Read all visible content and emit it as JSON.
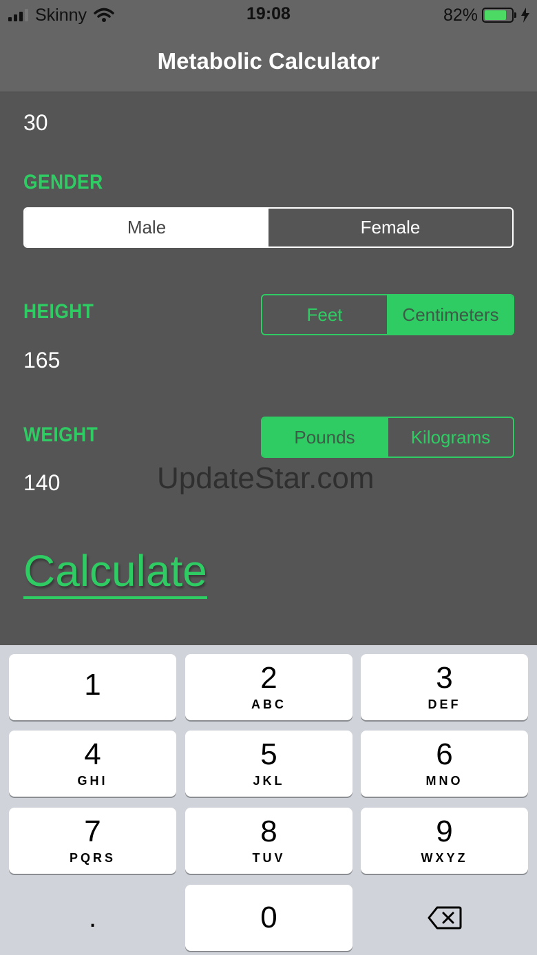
{
  "status_bar": {
    "carrier": "Skinny",
    "time": "19:08",
    "battery": "82%",
    "battery_level": 0.82
  },
  "nav": {
    "title": "Metabolic Calculator"
  },
  "form": {
    "age_value": "30",
    "gender": {
      "label": "GENDER",
      "options": [
        "Male",
        "Female"
      ],
      "selected": "Male"
    },
    "height": {
      "label": "HEIGHT",
      "value": "165",
      "units": [
        "Feet",
        "Centimeters"
      ],
      "selected_unit": "Centimeters"
    },
    "weight": {
      "label": "WEIGHT",
      "value": "140",
      "units": [
        "Pounds",
        "Kilograms"
      ],
      "selected_unit": "Pounds"
    },
    "calculate_label": "Calculate"
  },
  "watermark": "UpdateStar.com",
  "keyboard": {
    "keys": [
      {
        "num": "1",
        "letters": ""
      },
      {
        "num": "2",
        "letters": "ABC"
      },
      {
        "num": "3",
        "letters": "DEF"
      },
      {
        "num": "4",
        "letters": "GHI"
      },
      {
        "num": "5",
        "letters": "JKL"
      },
      {
        "num": "6",
        "letters": "MNO"
      },
      {
        "num": "7",
        "letters": "PQRS"
      },
      {
        "num": "8",
        "letters": "TUV"
      },
      {
        "num": "9",
        "letters": "WXYZ"
      },
      {
        "num": "0",
        "letters": ""
      }
    ],
    "decimal": "."
  },
  "colors": {
    "accent": "#2ecc63",
    "background": "#555555",
    "nav": "#656565",
    "keyboard": "#d0d3d9"
  },
  "icons": [
    "signal-icon",
    "wifi-icon",
    "battery-icon",
    "charging-icon",
    "backspace-icon"
  ]
}
